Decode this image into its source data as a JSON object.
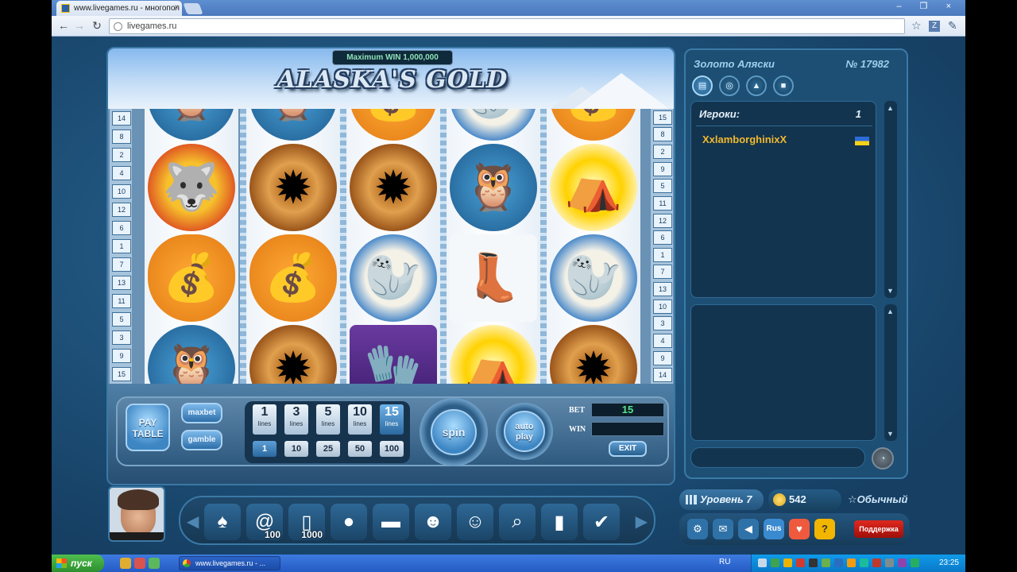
{
  "browser": {
    "tab_title": "www.livegames.ru - многопол",
    "tab_close": "×",
    "window_controls": "– ❐ ×",
    "url": "livegames.ru"
  },
  "game": {
    "max_win": "Maximum WIN 1,000,000",
    "title": "ALASKA'S GOLD",
    "left_line_numbers": [
      "14",
      "8",
      "2",
      "4",
      "10",
      "12",
      "6",
      "1",
      "7",
      "13",
      "11",
      "5",
      "3",
      "9",
      "15"
    ],
    "right_line_numbers": [
      "15",
      "8",
      "2",
      "9",
      "5",
      "11",
      "12",
      "6",
      "1",
      "7",
      "13",
      "10",
      "3",
      "4",
      "9",
      "14"
    ],
    "controls": {
      "pay_table": "PAY TABLE",
      "maxbet": "maxbet",
      "gamble": "gamble",
      "lines": [
        {
          "value": "1",
          "sub": "lines"
        },
        {
          "value": "3",
          "sub": "lines"
        },
        {
          "value": "5",
          "sub": "lines"
        },
        {
          "value": "10",
          "sub": "lines"
        },
        {
          "value": "15",
          "sub": "lines"
        }
      ],
      "bets": [
        "1",
        "10",
        "25",
        "50",
        "100"
      ],
      "spin": "spin",
      "auto_play": "auto play",
      "bet_label": "BET",
      "bet_value": "15",
      "win_label": "WIN",
      "win_value": "",
      "exit": "EXIT"
    }
  },
  "chat": {
    "room_title": "Золото Аляски",
    "room_number": "№ 17982",
    "players_label": "Игроки:",
    "players_count": "1",
    "player_name": "XxlamborghinixX"
  },
  "status": {
    "level": "Уровень 7",
    "coins": "542",
    "rank": "Обычный",
    "support": "Поддержка",
    "lang_button": "Rus"
  },
  "game_bar": {
    "icons": [
      {
        "name": "poker-icon",
        "glyph": "♠",
        "num": ""
      },
      {
        "name": "at-100-icon",
        "glyph": "@",
        "num": "100"
      },
      {
        "name": "phone-1000-icon",
        "glyph": "▯",
        "num": "1000"
      },
      {
        "name": "gold-coin-icon",
        "glyph": "●",
        "num": ""
      },
      {
        "name": "wallet-icon",
        "glyph": "▬",
        "num": ""
      },
      {
        "name": "emoticons-icon",
        "glyph": "☻",
        "num": ""
      },
      {
        "name": "friends-icon",
        "glyph": "☺",
        "num": ""
      },
      {
        "name": "search-user-icon",
        "glyph": "⌕",
        "num": ""
      },
      {
        "name": "rating-chart-icon",
        "glyph": "▮",
        "num": ""
      },
      {
        "name": "check-card-icon",
        "glyph": "✔",
        "num": ""
      }
    ]
  },
  "taskbar": {
    "start": "пуск",
    "task_item": "www.livegames.ru - ...",
    "lang": "RU",
    "clock": "23:25"
  }
}
